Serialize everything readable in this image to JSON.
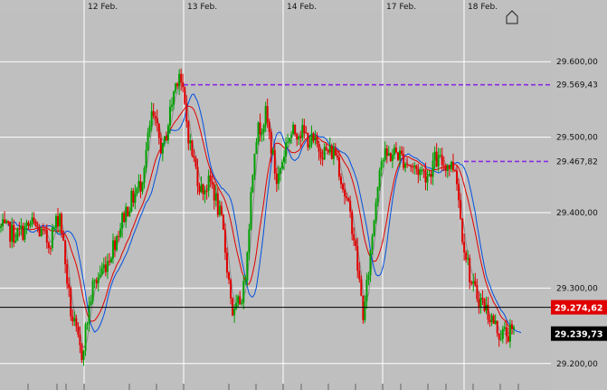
{
  "chart_data": {
    "type": "candlestick",
    "title": "",
    "x_dates": [
      "12 Feb.",
      "13 Feb.",
      "14 Feb.",
      "17 Feb.",
      "18 Feb."
    ],
    "y_tick_labels": [
      "29.600,00",
      "29.500,00",
      "29.400,00",
      "29.300,00",
      "29.200,00"
    ],
    "y_ticks": [
      29600,
      29500,
      29400,
      29300,
      29200
    ],
    "ylim": [
      29165,
      29665
    ],
    "grid": true,
    "horizontal_levels": [
      {
        "label": "29.569,43",
        "value": 29569.43,
        "style": "dashed",
        "color": "#8a2be2"
      },
      {
        "label": "29.467,82",
        "value": 29467.82,
        "style": "dashed",
        "color": "#8a2be2"
      }
    ],
    "reference_line": {
      "label": "29.274,62",
      "value": 29274.62,
      "color": "#e00000"
    },
    "last_price": {
      "label": "29.239,73",
      "value": 29239.73,
      "color": "#000000"
    },
    "series": [
      {
        "name": "",
        "kind": "candles",
        "up_color": "#00a000",
        "down_color": "#e00000"
      },
      {
        "name": "",
        "kind": "line",
        "color": "#e00000"
      },
      {
        "name": "",
        "kind": "line",
        "color": "#0050e0"
      },
      {
        "name": "",
        "kind": "line",
        "color": "#8c8c8c"
      }
    ],
    "price_path": [
      [
        0,
        29380
      ],
      [
        0.03,
        29370
      ],
      [
        0.06,
        29385
      ],
      [
        0.09,
        29360
      ],
      [
        0.11,
        29400
      ],
      [
        0.13,
        29270
      ],
      [
        0.15,
        29210
      ],
      [
        0.17,
        29300
      ],
      [
        0.2,
        29340
      ],
      [
        0.23,
        29400
      ],
      [
        0.26,
        29440
      ],
      [
        0.28,
        29530
      ],
      [
        0.3,
        29480
      ],
      [
        0.32,
        29560
      ],
      [
        0.33,
        29590
      ],
      [
        0.35,
        29490
      ],
      [
        0.37,
        29430
      ],
      [
        0.39,
        29440
      ],
      [
        0.41,
        29380
      ],
      [
        0.43,
        29260
      ],
      [
        0.45,
        29300
      ],
      [
        0.47,
        29500
      ],
      [
        0.49,
        29530
      ],
      [
        0.51,
        29440
      ],
      [
        0.53,
        29500
      ],
      [
        0.55,
        29510
      ],
      [
        0.58,
        29490
      ],
      [
        0.6,
        29480
      ],
      [
        0.62,
        29480
      ],
      [
        0.63,
        29440
      ],
      [
        0.65,
        29380
      ],
      [
        0.67,
        29260
      ],
      [
        0.7,
        29470
      ],
      [
        0.73,
        29480
      ],
      [
        0.76,
        29460
      ],
      [
        0.79,
        29450
      ],
      [
        0.8,
        29470
      ],
      [
        0.84,
        29460
      ],
      [
        0.85,
        29380
      ],
      [
        0.87,
        29300
      ],
      [
        0.89,
        29280
      ],
      [
        0.92,
        29240
      ],
      [
        0.95,
        29240
      ]
    ]
  }
}
